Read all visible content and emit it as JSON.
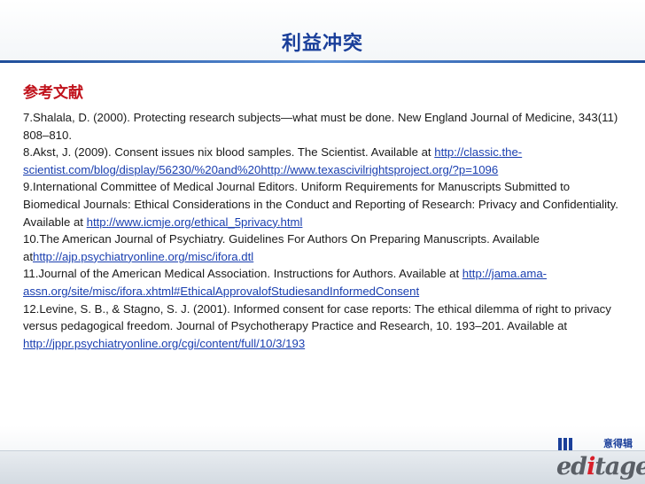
{
  "slide": {
    "title": "利益冲突",
    "references_heading": "参考文献"
  },
  "references": [
    {
      "parts": [
        {
          "text": "7.Shalala, D. (2000). Protecting research subjects—what must be done. New England Journal of Medicine, 343(11) 808–810."
        }
      ]
    },
    {
      "parts": [
        {
          "text": "8.Akst, J. (2009). Consent issues nix blood samples. The Scientist. Available at "
        },
        {
          "link": "http://classic.the-scientist.com/blog/display/56230/%20and%20http://www.texascivilrightsproject.org/?p=1096"
        }
      ]
    },
    {
      "parts": [
        {
          "text": "9.International Committee of Medical Journal Editors. Uniform Requirements for Manuscripts Submitted to Biomedical Journals: Ethical Considerations in the Conduct and Reporting of Research: Privacy and Confidentiality. Available at "
        },
        {
          "link": "http://www.icmje.org/ethical_5privacy.html"
        }
      ]
    },
    {
      "parts": [
        {
          "text": "10.The American Journal of Psychiatry. Guidelines For Authors On Preparing Manuscripts. Available at"
        },
        {
          "link": "http://ajp.psychiatryonline.org/misc/ifora.dtl"
        }
      ]
    },
    {
      "parts": [
        {
          "text": "11.Journal of the American Medical Association. Instructions for Authors. Available at "
        },
        {
          "link": "http://jama.ama-assn.org/site/misc/ifora.xhtml#EthicalApprovalofStudiesandInformedConsent"
        }
      ]
    },
    {
      "parts": [
        {
          "text": "12.Levine, S. B., & Stagno, S. J. (2001). Informed consent for case reports: The ethical dilemma of right to privacy versus pedagogical freedom. Journal of Psychotherapy Practice and Research, 10. 193–201. Available at "
        },
        {
          "link": "http://jppr.psychiatryonline.org/cgi/content/full/10/3/193"
        }
      ]
    }
  ],
  "logo": {
    "chinese": "意得辑",
    "wordmark_pre": "ed",
    "wordmark_accent": "i",
    "wordmark_post": "tage"
  },
  "colors": {
    "title": "#1a3f9a",
    "heading": "#c0121b",
    "link": "#1a3fb0"
  }
}
